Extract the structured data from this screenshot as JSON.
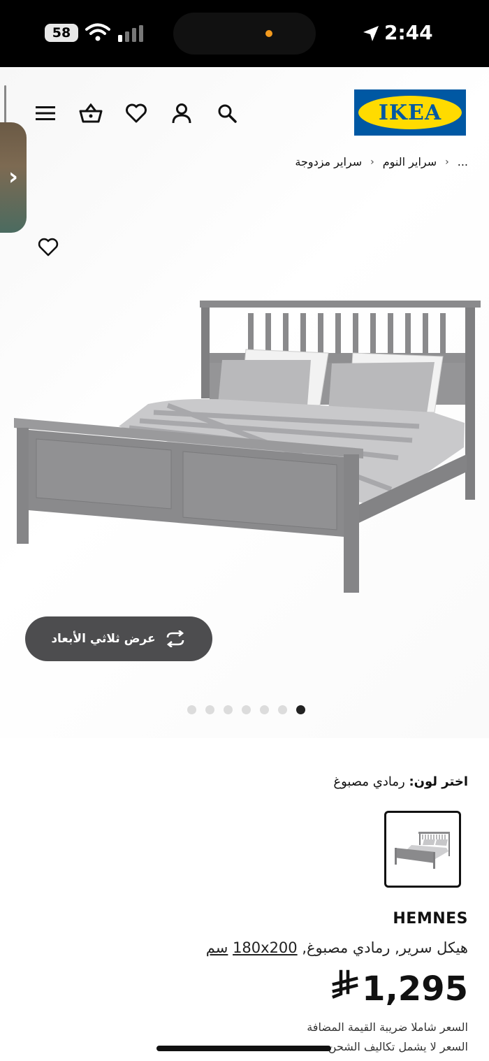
{
  "status_bar": {
    "battery": "58",
    "time": "2:44"
  },
  "header": {
    "logo_text": "IKEA"
  },
  "breadcrumb": {
    "items": [
      "...",
      "سراير النوم",
      "سراير مزدوجة"
    ]
  },
  "gallery": {
    "view_3d_label": "عرض ثلاثي الأبعاد",
    "dots_total": 7,
    "active_dot": 6
  },
  "color": {
    "label": "اختر لون:",
    "value": "رمادي مصبوغ"
  },
  "product": {
    "name": "HEMNES",
    "description_prefix": "هيكل سرير, رمادي مصبوغ,",
    "size_link": "180x200",
    "size_unit": "سم",
    "currency_symbol": "⃁",
    "price": "1,295",
    "vat_note": "السعر شاملا ضريبة القيمة المضافة",
    "shipping_note": "السعر لا يشمل تكاليف الشحن"
  },
  "colors": {
    "ikea_blue": "#0058a3",
    "ikea_yellow": "#ffdb00",
    "bed_gray": "#8a8a8c",
    "button_dark": "#4d4d4f"
  }
}
